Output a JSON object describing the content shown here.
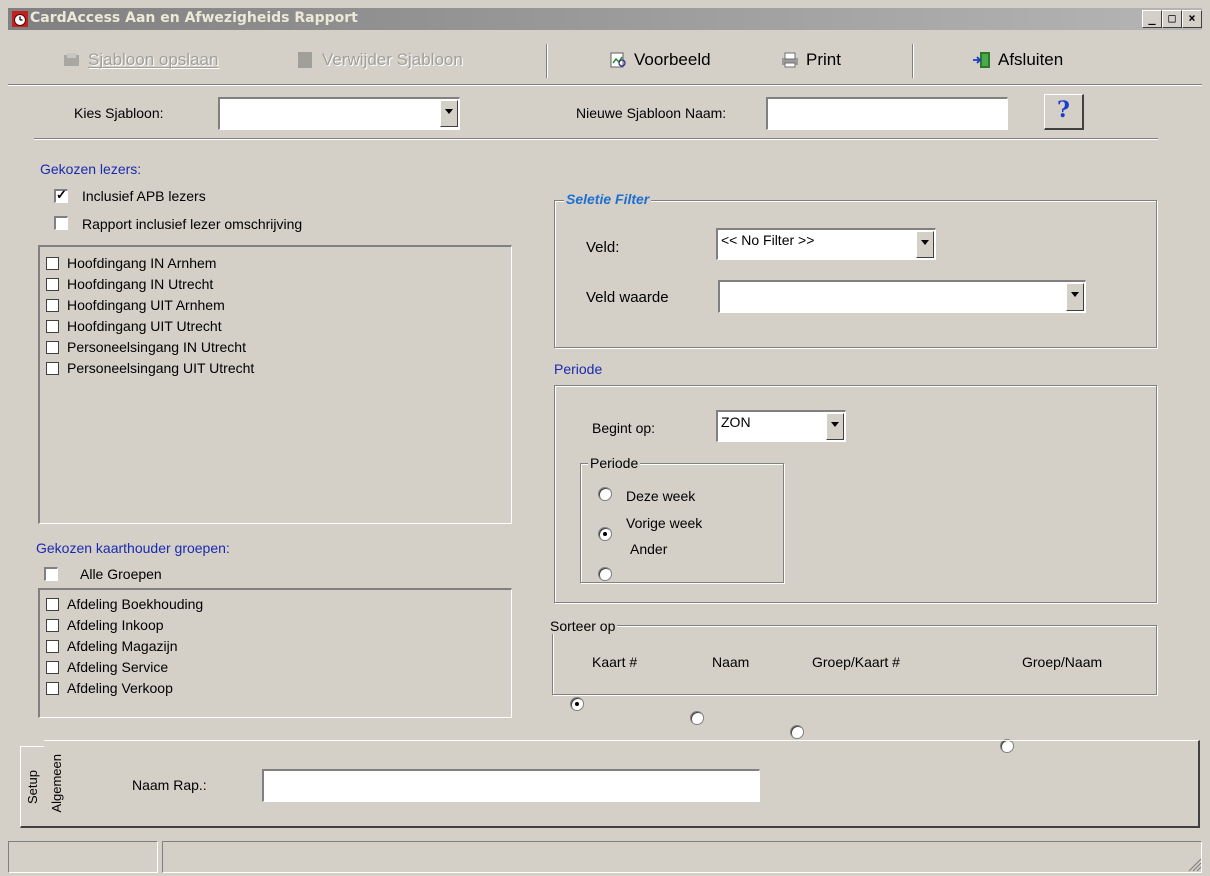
{
  "window": {
    "title": "CardAccess Aan en Afwezigheids Rapport",
    "minimize": "_",
    "maximize": "□",
    "close": "×"
  },
  "toolbar": {
    "save_template": "Sjabloon opslaan",
    "delete_template": "Verwijder Sjabloon",
    "preview": "Voorbeeld",
    "print": "Print",
    "close": "Afsluiten"
  },
  "template": {
    "choose_label": "Kies Sjabloon:",
    "choose_value": "",
    "new_name_label": "Nieuwe Sjabloon Naam:",
    "new_name_value": "",
    "help": "?"
  },
  "readers": {
    "title": "Gekozen lezers:",
    "include_apb_label": "Inclusief APB lezers",
    "include_apb_checked": true,
    "include_desc_label": "Rapport inclusief lezer omschrijving",
    "include_desc_checked": false,
    "items": [
      "Hoofdingang IN Arnhem",
      "Hoofdingang IN Utrecht",
      "Hoofdingang UIT Arnhem",
      "Hoofdingang UIT Utrecht",
      "Personeelsingang IN Utrecht",
      "Personeelsingang UIT Utrecht"
    ]
  },
  "groups": {
    "title": "Gekozen kaarthouder groepen:",
    "all_label": "Alle Groepen",
    "items": [
      "Afdeling Boekhouding",
      "Afdeling Inkoop",
      "Afdeling Magazijn",
      "Afdeling Service",
      "Afdeling Verkoop"
    ]
  },
  "filter": {
    "title": "Seletie Filter",
    "field_label": "Veld:",
    "field_value": "<< No Filter >>",
    "value_label": "Veld waarde",
    "value_value": ""
  },
  "period": {
    "title": "Periode",
    "starts_label": "Begint op:",
    "starts_value": "ZON",
    "inner_title": "Periode",
    "options": [
      "Deze week",
      "Vorige week",
      "Ander"
    ],
    "selected": "Vorige week"
  },
  "sort": {
    "title": "Sorteer op",
    "options": [
      "Kaart #",
      "Naam",
      "Groep/Kaart #",
      "Groep/Naam"
    ],
    "selected": "Kaart #"
  },
  "tabs": {
    "setup": "Setup",
    "general": "Algemeen",
    "report_name_label": "Naam Rap.:",
    "report_name_value": ""
  },
  "colors": {
    "background": "#d4d0c8",
    "label_blue": "#1a2ab0",
    "filter_title_blue": "#1d6fd0"
  },
  "icons": {
    "save": "save-template-icon",
    "delete": "delete-template-icon",
    "preview": "preview-icon",
    "print": "print-icon",
    "exit": "exit-icon",
    "app": "app-clock-icon"
  }
}
